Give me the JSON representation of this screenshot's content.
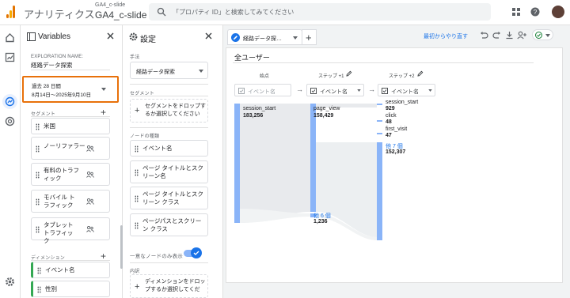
{
  "topbar": {
    "app_title": "アナリティクス",
    "account": "GA4_c-slide",
    "property": "GA4_c-slide",
    "search_placeholder": "「プロパティ ID」と検索してみてください"
  },
  "variables": {
    "title": "Variables",
    "exploration_label": "EXPLORATION NAME:",
    "exploration_name": "経路データ探索",
    "date_label": "過去 28 日間",
    "date_value": "8月14日～2025年9月10日",
    "segments_label": "セグメント",
    "segments": [
      "米国",
      "ノーリファラー",
      "有料のトラフィック",
      "モバイル トラフィック",
      "タブレット トラフィック"
    ],
    "dimensions_label": "ディメンション",
    "dimensions": [
      "イベント名",
      "性別"
    ]
  },
  "settings": {
    "title": "設定",
    "technique_label": "手法",
    "technique_value": "経路データ探索",
    "segment_label": "セグメント",
    "segment_drop": "セグメントをドロップするか選択してください",
    "node_type_label": "ノードの種類",
    "node_types": [
      "イベント名",
      "ページ タイトルとスクリーン名",
      "ページ タイトルとスクリーン クラス",
      "ページパスとスクリーン クラス"
    ],
    "unique_nodes_label": "一意なノードのみ表示",
    "breakdown_label": "内訳",
    "dimension_drop": "ディメンションをドロップするか選択してくだ"
  },
  "canvas": {
    "tab_label": "経路データ探…",
    "restart_link": "最初からやり直す",
    "title": "全ユーザー",
    "start_label": "始点",
    "step1_label": "ステップ +1",
    "step2_label": "ステップ +2",
    "start_select": "イベント名",
    "step1_select": "イベント名",
    "step2_select": "イベント名",
    "nodes": {
      "start": {
        "name": "session_start",
        "value": "183,256"
      },
      "step1_main": {
        "name": "page_view",
        "value": "158,429"
      },
      "step1_other": {
        "name": "他 6 個",
        "value": "1,236"
      },
      "step2": [
        {
          "name": "session_start",
          "value": "929"
        },
        {
          "name": "click",
          "value": "48"
        },
        {
          "name": "first_visit",
          "value": "47"
        },
        {
          "name": "他 7 個",
          "value": "152,307"
        }
      ]
    }
  },
  "colors": {
    "accent": "#1a73e8",
    "highlight": "#e8710a",
    "bar": "#8ab4f8",
    "dimension_chip": "#34a853"
  }
}
